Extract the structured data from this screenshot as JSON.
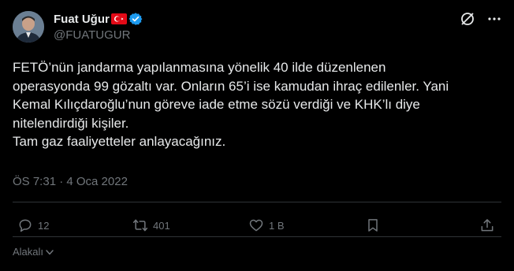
{
  "author": {
    "display_name": "Fuat Uğur",
    "handle": "@FUATUGUR"
  },
  "tweet": {
    "text": "FETÖ’nün jandarma yapılanmasına yönelik 40 ilde düzenlenen\noperasyonda 99 gözaltı var. Onların 65’i ise kamudan ihraç edilenler. Yani\nKemal Kılıçdaroğlu’nun göreve iade etme sözü verdiği ve KHK’lı diye\nnitelendirdiği kişiler.\nTam gaz faaliyetteler anlayacağınız.",
    "timestamp": "ÖS 7:31 · 4 Oca 2022"
  },
  "actions": {
    "replies": "12",
    "reposts": "401",
    "likes": "1 B"
  },
  "related_label": "Alakalı",
  "icons": {
    "header": [
      "grok-icon",
      "more-icon"
    ],
    "flag": "turkey-flag-icon",
    "verified": "verified-badge-icon"
  },
  "colors": {
    "background": "#000000",
    "text": "#e7e9ea",
    "muted": "#71767b",
    "verified": "#1d9bf0",
    "flag": "#e30a17"
  }
}
